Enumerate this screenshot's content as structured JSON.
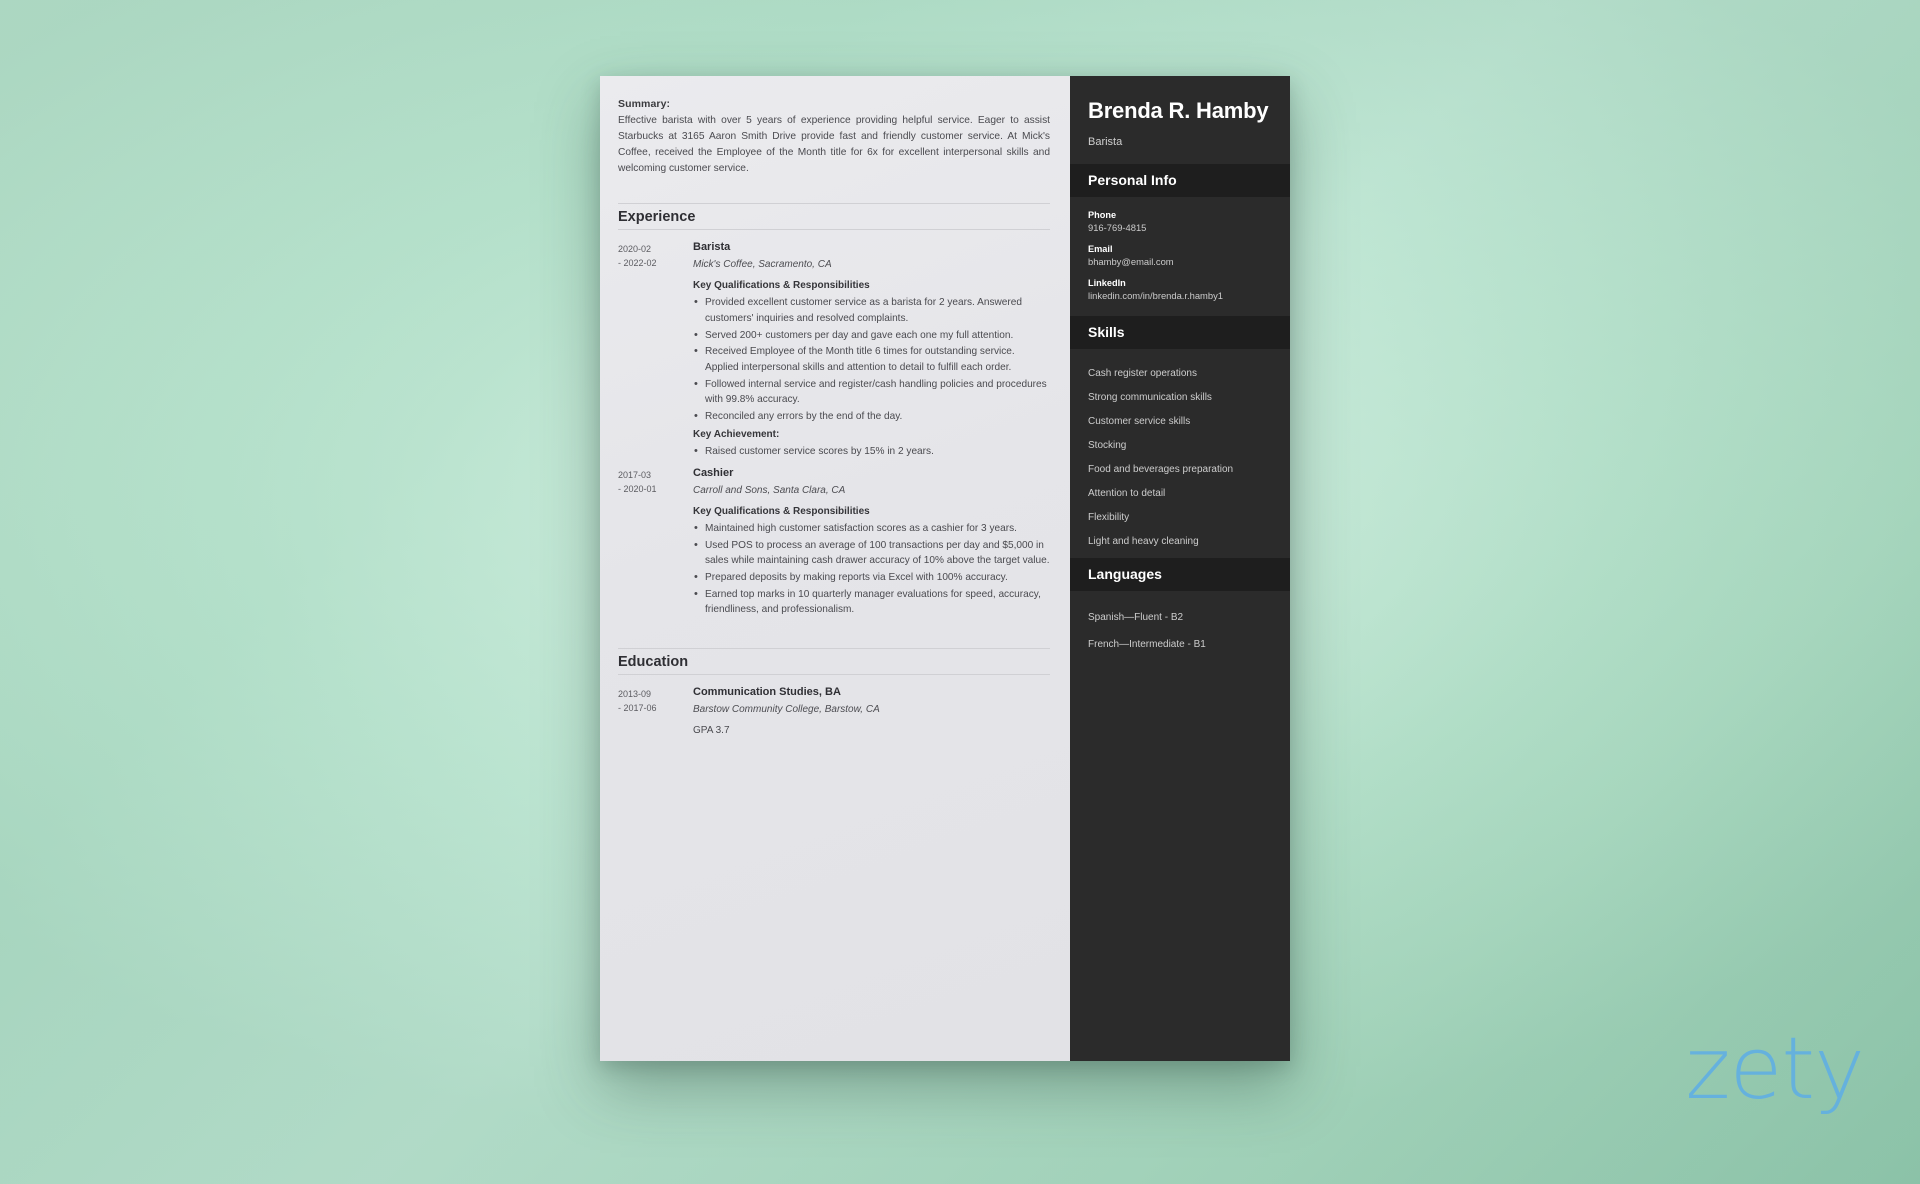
{
  "background": {
    "color_from": "#b9e2cd",
    "color_to": "#8fc7ac"
  },
  "watermark": {
    "text": "zety",
    "color": "#62b0e2"
  },
  "resume": {
    "summary": {
      "label": "Summary:",
      "text": "Effective barista with over 5 years of experience providing helpful service. Eager to assist Starbucks at 3165 Aaron Smith Drive provide fast and friendly customer service. At Mick's Coffee, received the Employee of the Month title for 6x for excellent interpersonal skills and welcoming customer service."
    },
    "experience": {
      "title": "Experience",
      "entries": [
        {
          "date_start": "2020-02",
          "date_end": "- 2022-02",
          "role": "Barista",
          "org": "Mick's Coffee, Sacramento, CA",
          "qualifications_label": "Key Qualifications & Responsibilities",
          "bullets": [
            "Provided excellent customer service as a barista for 2 years. Answered customers' inquiries and resolved complaints.",
            "Served 200+ customers per day and gave each one my full attention.",
            "Received Employee of the Month title 6 times for outstanding service. Applied interpersonal skills and attention to detail to fulfill each order.",
            "Followed internal service and register/cash handling policies and procedures with 99.8% accuracy.",
            "Reconciled any errors by the end of the day."
          ],
          "achievement_label": "Key Achievement:",
          "achievements": [
            "Raised customer service scores by 15% in 2 years."
          ]
        },
        {
          "date_start": "2017-03",
          "date_end": "- 2020-01",
          "role": "Cashier",
          "org": "Carroll and Sons, Santa Clara, CA",
          "qualifications_label": "Key Qualifications & Responsibilities",
          "bullets": [
            "Maintained high customer satisfaction scores as a cashier for 3 years.",
            "Used POS to process an average of 100 transactions per day and $5,000 in sales while maintaining cash drawer accuracy of 10% above the target value.",
            "Prepared deposits by making reports via Excel with 100% accuracy.",
            "Earned top marks in 10 quarterly manager evaluations for speed, accuracy, friendliness, and professionalism."
          ],
          "achievement_label": "",
          "achievements": []
        }
      ]
    },
    "education": {
      "title": "Education",
      "entries": [
        {
          "date_start": "2013-09",
          "date_end": "- 2017-06",
          "degree": "Communication Studies, BA",
          "school": "Barstow Community College, Barstow, CA",
          "gpa": "GPA 3.7"
        }
      ]
    },
    "sidebar": {
      "name": "Brenda R. Hamby",
      "job_title": "Barista",
      "personal_info": {
        "heading": "Personal Info",
        "items": [
          {
            "key": "Phone",
            "value": "916-769-4815"
          },
          {
            "key": "Email",
            "value": "bhamby@email.com"
          },
          {
            "key": "LinkedIn",
            "value": "linkedin.com/in/brenda.r.hamby1"
          }
        ]
      },
      "skills": {
        "heading": "Skills",
        "items": [
          "Cash register operations",
          "Strong communication skills",
          "Customer service skills",
          "Stocking",
          "Food and beverages preparation",
          "Attention to detail",
          "Flexibility",
          "Light and heavy cleaning"
        ]
      },
      "languages": {
        "heading": "Languages",
        "items": [
          "Spanish—Fluent - B2",
          "French—Intermediate - B1"
        ]
      }
    }
  }
}
